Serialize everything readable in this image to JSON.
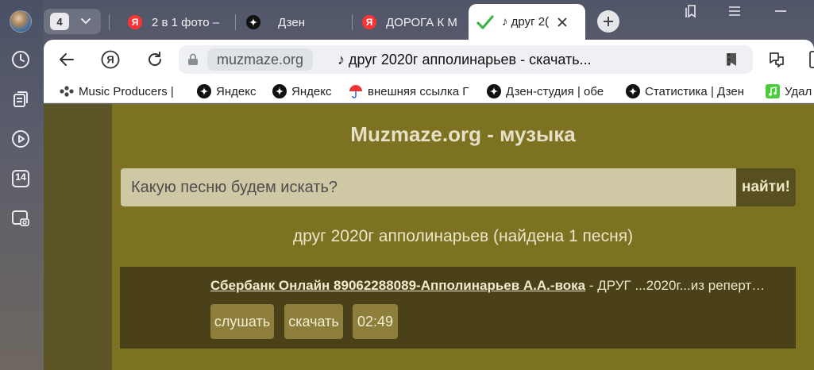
{
  "sidebar": {
    "icons": [
      "clock-icon",
      "collections-icon",
      "play-circle-icon",
      "calendar-14-icon",
      "screenshot-icon"
    ],
    "calendar_day": "14"
  },
  "tabs": {
    "count": "4",
    "items": [
      {
        "title": "2 в 1 фото –",
        "favicon": "yandex-icon"
      },
      {
        "title": "Дзен",
        "favicon": "zen-icon"
      },
      {
        "title": "ДОРОГА К М",
        "favicon": "yandex-icon"
      },
      {
        "title": "♪ друг 2(",
        "favicon": "checkmark-icon",
        "active": true
      }
    ]
  },
  "address": {
    "domain": "muzmaze.org",
    "page_title": "♪ друг 2020г апполинарьев - скачать..."
  },
  "bookmarks": [
    {
      "label": "Music Producers |",
      "icon": "dots-icon"
    },
    {
      "label": "Яндекс",
      "icon": "zen-icon"
    },
    {
      "label": "Яндекс",
      "icon": "zen-icon"
    },
    {
      "label": "внешняя ссылка Г",
      "icon": "umbrella-icon"
    },
    {
      "label": "Дзен-студия | обе",
      "icon": "zen-icon"
    },
    {
      "label": "Статистика | Дзен",
      "icon": "zen-icon"
    },
    {
      "label": "Удал",
      "icon": "music-note-icon"
    }
  ],
  "site": {
    "title": "Muzmaze.org - музыка",
    "search_placeholder": "Какую песню будем искать?",
    "search_button": "найти!",
    "results_heading": "друг 2020г апполинарьев (найдена 1 песня)",
    "result": {
      "link": "Сбербанк Онлайн 89062288089-Апполинарьев А.А.-вока",
      "rest": " - ДРУГ ...2020г...из реперт…",
      "listen": "слушать",
      "download": "скачать",
      "duration": "02:49"
    }
  },
  "colors": {
    "page_bg": "#7d7122",
    "search_field": "#cfc8a5",
    "result_bg": "#4a4119",
    "button_bg": "#8d7f3b"
  }
}
